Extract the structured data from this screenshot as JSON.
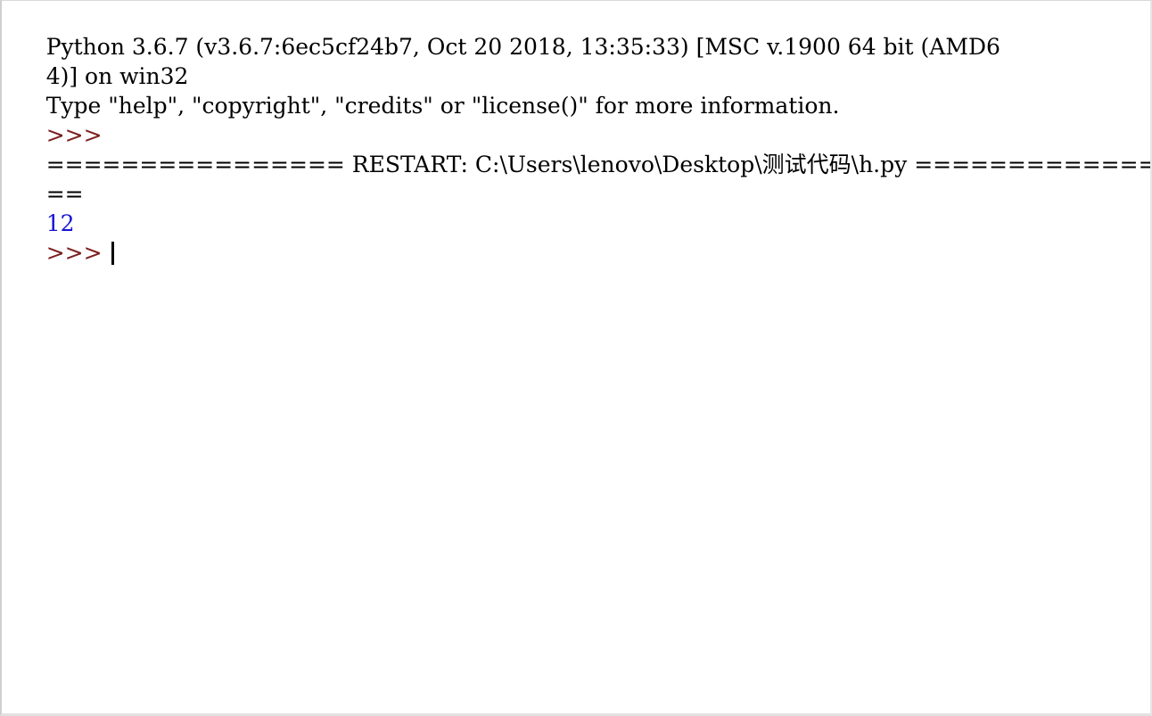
{
  "window": {
    "app": "Python IDLE Shell",
    "background_color": "#ffffff",
    "text_color": "#000000",
    "prompt_color": "#7c2020",
    "output_color": "#1414d6",
    "border_color": "#cfcfcf"
  },
  "shell": {
    "lines": [
      {
        "id": "banner-version",
        "kind": "banner",
        "text": "Python 3.6.7 (v3.6.7:6ec5cf24b7, Oct 20 2018, 13:35:33) [MSC v.1900 64 bit (AMD6",
        "color": "#000000"
      },
      {
        "id": "banner-version-wrap",
        "kind": "banner",
        "text": "4)] on win32",
        "color": "#000000"
      },
      {
        "id": "banner-help",
        "kind": "banner",
        "text": "Type \"help\", \"copyright\", \"credits\" or \"license()\" for more information.",
        "color": "#000000"
      },
      {
        "id": "prompt-1",
        "kind": "prompt",
        "text": ">>>",
        "color": "#7c2020"
      },
      {
        "id": "restart-banner",
        "kind": "restart",
        "text": "================ RESTART: C:\\Users\\lenovo\\Desktop\\测试代码\\h.py ==============",
        "color": "#000000"
      },
      {
        "id": "restart-banner-wrap",
        "kind": "restart",
        "text": "==",
        "color": "#000000"
      },
      {
        "id": "output-1",
        "kind": "output",
        "text": "12",
        "color": "#1414d6"
      },
      {
        "id": "prompt-2",
        "kind": "prompt",
        "text": ">>>",
        "color": "#7c2020",
        "has_caret": true
      }
    ],
    "restart_parts": {
      "left_equals": "================",
      "label": " RESTART: ",
      "path": "C:\\Users\\lenovo\\Desktop\\测试代码\\h.py",
      "right_equals": " ==============",
      "wrapped_equals": "=="
    },
    "program_output_value": "12",
    "prompt_symbol": ">>>",
    "caret_visible": true
  }
}
